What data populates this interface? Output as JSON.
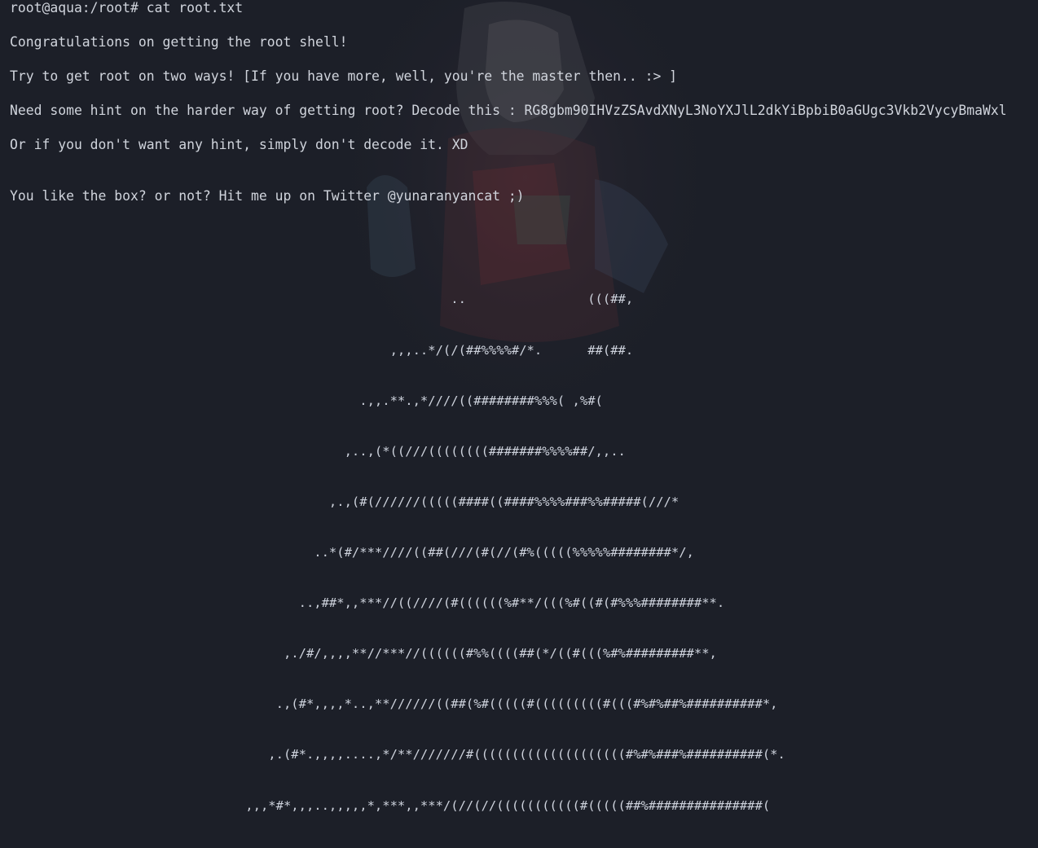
{
  "prompt": "root@aqua:/root# cat root.txt",
  "lines": {
    "congrats": "Congratulations on getting the root shell!",
    "try": "Try to get root on two ways! [If you have more, well, you're the master then.. :> ]",
    "hint": "Need some hint on the harder way of getting root? Decode this : RG8gbm90IHVzZSAvdXNyL3NoYXJlL2dkYiBpbiB0aGUgc3Vkb2VycyBmaWxl",
    "nohint": "Or if you don't want any hint, simply don't decode it. XD",
    "twitter": "You like the box? or not? Hit me up on Twitter @yunaranyancat ;)"
  },
  "ascii_art": [
    "                                                          ..                (((##,",
    "                                                  ,,,..*/(/(##%%%%#/*.      ##(##.",
    "                                              .,,.**.,*////((########%%%( ,%#(",
    "                                            ,..,(*((///((((((((#######%%%%##/,,..",
    "                                          ,.,(#(//////(((((####((####%%%%###%%#####(///*",
    "                                        ..*(#/***////((##(///(#(//(#%(((((%%%%%########*/,",
    "                                      ..,##*,,***//((////(#((((((%#**/(((%#((#(#%%%########**.",
    "                                    ,./#/,,,,**//***//((((((#%%((((##(*/((#(((%#%#########**,",
    "                                   .,(#*,,,,*..,**//////((##(%#(((((#(((((((((#(((#%#%##%##########*,",
    "                                  ,.(#*.,,,,....,*/**///////#((((((((((((((((((((#%#%###%##########(*.",
    "                               ,,,*#*,,,..,,,,,*,***,,***/(//(//(((((((((((#(((((##%###############("
  ]
}
